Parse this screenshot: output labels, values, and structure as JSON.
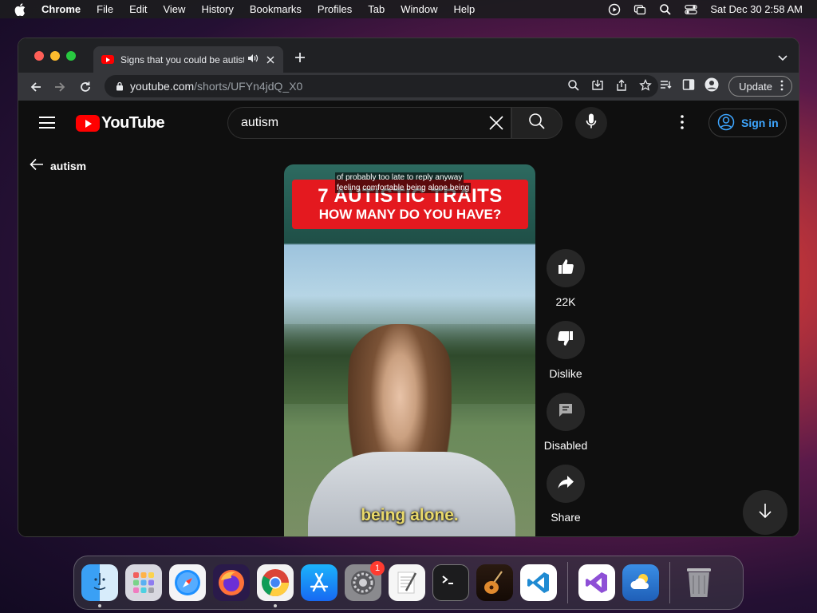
{
  "menubar": {
    "app_name": "Chrome",
    "items": [
      "File",
      "Edit",
      "View",
      "History",
      "Bookmarks",
      "Profiles",
      "Tab",
      "Window",
      "Help"
    ],
    "datetime": "Sat Dec 30  2:58 AM"
  },
  "browser": {
    "tab_title": "Signs that you could be autistic",
    "url_host": "youtube.com",
    "url_path": "/shorts/UFYn4jdQ_X0",
    "update_label": "Update"
  },
  "youtube": {
    "logo_text": "YouTube",
    "search_value": "autism",
    "sign_in_label": "Sign in",
    "back_label": "autism",
    "short": {
      "caption_line1": "of probably too late to reply anyway",
      "caption_line2": "feeling comfortable being alone being",
      "banner_line1": "7 AUTISTIC TRAITS",
      "banner_line2": "HOW MANY DO YOU HAVE?",
      "subtitle": "being alone."
    },
    "actions": {
      "like_count": "22K",
      "dislike_label": "Dislike",
      "comments_label": "Disabled",
      "share_label": "Share"
    }
  },
  "dock": {
    "settings_badge": "1"
  },
  "colors": {
    "youtube_red": "#ff0000",
    "link_blue": "#3ea6ff",
    "banner_red": "#e4191f",
    "subtitle_yellow": "#e9d96a"
  }
}
